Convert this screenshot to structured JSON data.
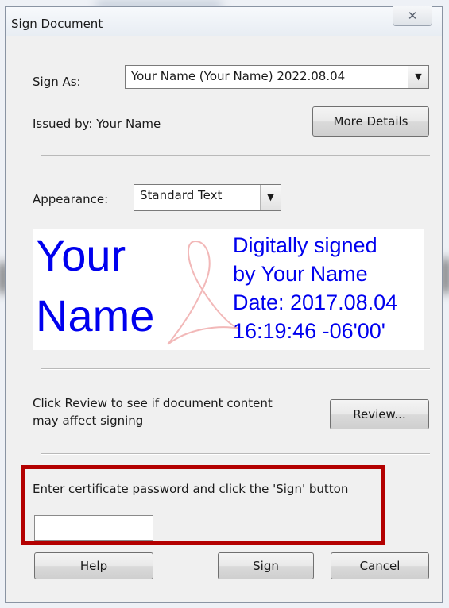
{
  "dialog": {
    "title": "Sign Document",
    "close_glyph": "✕",
    "sign_as": {
      "label": "Sign As:",
      "selected": "Your Name (Your Name) 2022.08.04"
    },
    "issued_by": "Issued by: Your Name",
    "more_details_label": "More Details",
    "appearance": {
      "label": "Appearance:",
      "selected": "Standard Text"
    },
    "signature_preview": {
      "name_line1": "Your",
      "name_line2": "Name",
      "details": [
        "Digitally signed",
        "by Your Name",
        "Date: 2017.08.04",
        "16:19:46 -06'00'"
      ],
      "text_color": "#0000ee",
      "watermark_color": "#f2b8b8"
    },
    "review_text_line1": "Click Review to see if document content",
    "review_text_line2": "may affect signing",
    "review_label": "Review...",
    "password_prompt": "Enter certificate password and click the 'Sign' button",
    "password_value": "",
    "buttons": {
      "help": "Help",
      "sign": "Sign",
      "cancel": "Cancel"
    },
    "highlight_color": "#b30000"
  }
}
